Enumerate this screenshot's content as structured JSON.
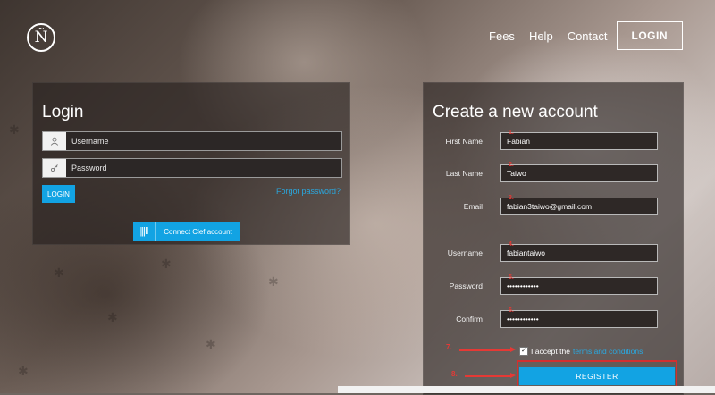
{
  "header": {
    "logo_text": "Ñ",
    "nav": [
      {
        "label": "Fees"
      },
      {
        "label": "Help"
      },
      {
        "label": "Contact"
      }
    ],
    "login_button": "LOGIN"
  },
  "login": {
    "title": "Login",
    "username_placeholder": "Username",
    "password_placeholder": "Password",
    "login_button": "LOGIN",
    "forgot_link": "Forgot password?",
    "clef_button": "Connect Clef account",
    "user_icon": "user-icon",
    "key_icon": "key-icon"
  },
  "register": {
    "title": "Create a new account",
    "fields": [
      {
        "label": "First Name",
        "value": "Fabian",
        "step": "1."
      },
      {
        "label": "Last Name",
        "value": "Taiwo",
        "step": "2."
      },
      {
        "label": "Email",
        "value": "fabian3taiwo@gmail.com",
        "step": "3."
      },
      {
        "label": "Username",
        "value": "fabiantaiwo",
        "step": "4."
      },
      {
        "label": "Password",
        "value": "••••••••••••",
        "step": "5."
      },
      {
        "label": "Confirm",
        "value": "••••••••••••",
        "step": "6."
      }
    ],
    "terms_prefix": "I accept the",
    "terms_link": "terms and conditions",
    "terms_checked": true,
    "register_button": "REGISTER",
    "annotations": {
      "step7": "7.",
      "step8": "8."
    }
  },
  "colors": {
    "accent": "#12a3e3",
    "annotation": "#e53935"
  }
}
